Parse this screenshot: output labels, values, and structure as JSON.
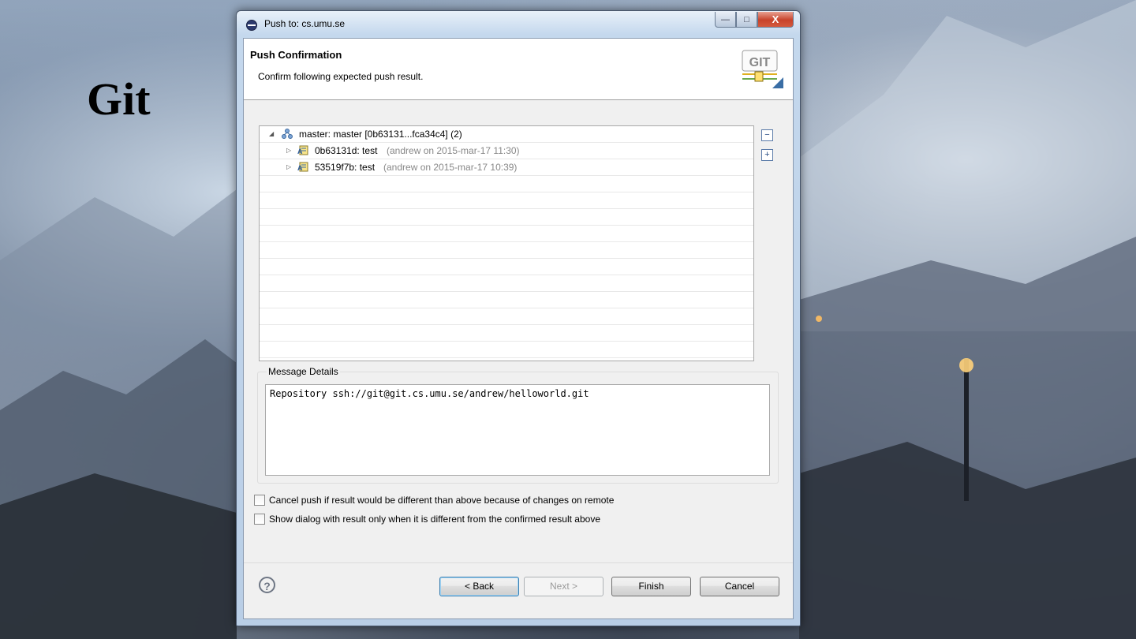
{
  "slide": {
    "title": "Git"
  },
  "window": {
    "title": "Push to: cs.umu.se",
    "controls": {
      "minimize": "—",
      "maximize": "□",
      "close": "X"
    }
  },
  "header": {
    "title": "Push Confirmation",
    "description": "Confirm following expected push result.",
    "logo_text": "GIT"
  },
  "tree": {
    "root": {
      "label": "master: master [0b63131...fca34c4] (2)",
      "icon": "remote-branch-icon"
    },
    "commits": [
      {
        "id": "0b63131d: test",
        "meta": "(andrew on 2015-mar-17 11:30)",
        "icon": "commit-icon"
      },
      {
        "id": "53519f7b: test",
        "meta": "(andrew on 2015-mar-17 10:39)",
        "icon": "commit-icon"
      }
    ],
    "collapse_all": "−",
    "expand_all": "+"
  },
  "message_details": {
    "label": "Message Details",
    "text": "Repository ssh://git@git.cs.umu.se/andrew/helloworld.git"
  },
  "options": [
    {
      "label": "Cancel push if result would be different than above because of changes on remote",
      "checked": false
    },
    {
      "label": "Show dialog with result only when it is different from the confirmed result above",
      "checked": false
    }
  ],
  "footer": {
    "help": "?",
    "back": "< Back",
    "next": "Next >",
    "finish": "Finish",
    "cancel": "Cancel"
  }
}
